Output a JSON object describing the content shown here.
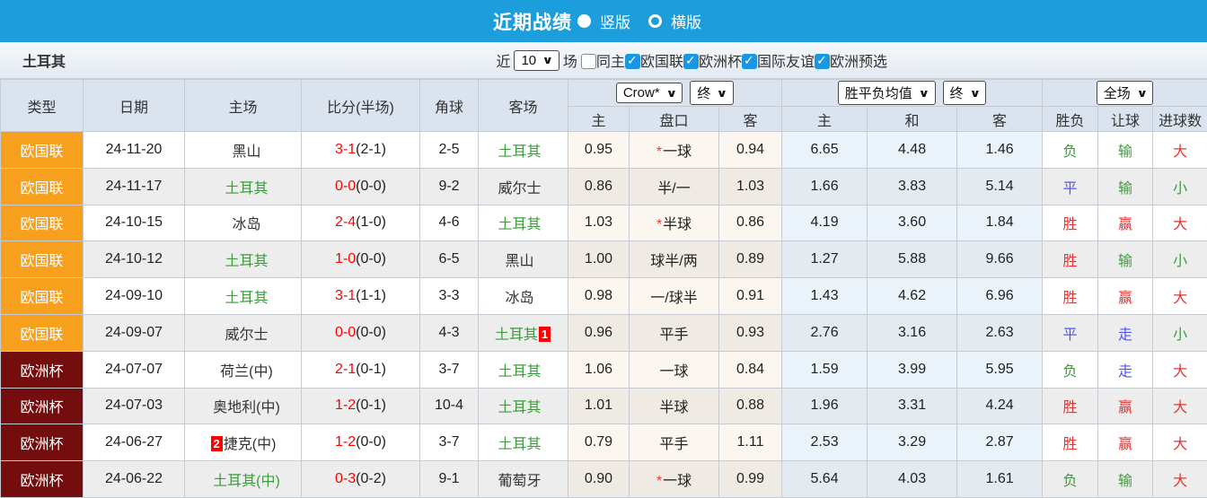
{
  "colors": {
    "topbar_blue": "#1C9EDC",
    "league_nations_orange": "#F7A01D",
    "league_euro_darkred": "#740D0D",
    "win_red": "#E83333",
    "lose_green": "#3E9B3E",
    "draw_blue": "#5353F2",
    "turkey_team_green": "#3E9B3E",
    "score_red": "#FF0000",
    "badge_red": "#FF0000"
  },
  "titlebar": {
    "title": "近期战绩",
    "radios": [
      {
        "label": "竖版",
        "selected": true
      },
      {
        "label": "横版",
        "selected": false
      }
    ]
  },
  "filterbar": {
    "team": "土耳其",
    "recent_label": "近",
    "recent_value": "10",
    "matches_label": "场",
    "checkboxes": [
      {
        "label": "同主",
        "checked": false
      },
      {
        "label": "欧国联",
        "checked": true
      },
      {
        "label": "欧洲杯",
        "checked": true
      },
      {
        "label": "国际友谊",
        "checked": true
      },
      {
        "label": "欧洲预选",
        "checked": true
      }
    ]
  },
  "table": {
    "selectors": {
      "bookmaker": "Crow*",
      "bookmaker_stage": "终",
      "avg_label": "胜平负均值",
      "avg_stage": "终",
      "scope": "全场"
    },
    "col_headers": {
      "type": "类型",
      "date": "日期",
      "home": "主场",
      "score": "比分(半场)",
      "corner": "角球",
      "away": "客场",
      "odds_home": "主",
      "odds_line": "盘口",
      "odds_away": "客",
      "avg_home": "主",
      "avg_draw": "和",
      "avg_away": "客",
      "result_wdl": "胜负",
      "result_handicap": "让球",
      "result_goals": "进球数"
    },
    "rows": [
      {
        "type": "欧国联",
        "date": "24-11-20",
        "home": "黑山",
        "home_turkey": false,
        "home_badge": "",
        "score": "3-1",
        "half": "(2-1)",
        "corner": "2-5",
        "away": "土耳其",
        "away_turkey": true,
        "away_badge": "",
        "odds_home": "0.95",
        "line": "*一球",
        "odds_away": "0.94",
        "avg_home": "6.65",
        "avg_draw": "4.48",
        "avg_away": "1.46",
        "wdl": {
          "text": "负",
          "tone": "green"
        },
        "hcp": {
          "text": "输",
          "tone": "green"
        },
        "goals": {
          "text": "大",
          "tone": "red"
        }
      },
      {
        "type": "欧国联",
        "date": "24-11-17",
        "home": "土耳其",
        "home_turkey": true,
        "home_badge": "",
        "score": "0-0",
        "half": "(0-0)",
        "corner": "9-2",
        "away": "威尔士",
        "away_turkey": false,
        "away_badge": "",
        "odds_home": "0.86",
        "line": "半/一",
        "odds_away": "1.03",
        "avg_home": "1.66",
        "avg_draw": "3.83",
        "avg_away": "5.14",
        "wdl": {
          "text": "平",
          "tone": "blue"
        },
        "hcp": {
          "text": "输",
          "tone": "green"
        },
        "goals": {
          "text": "小",
          "tone": "green"
        }
      },
      {
        "type": "欧国联",
        "date": "24-10-15",
        "home": "冰岛",
        "home_turkey": false,
        "home_badge": "",
        "score": "2-4",
        "half": "(1-0)",
        "corner": "4-6",
        "away": "土耳其",
        "away_turkey": true,
        "away_badge": "",
        "odds_home": "1.03",
        "line": "*半球",
        "odds_away": "0.86",
        "avg_home": "4.19",
        "avg_draw": "3.60",
        "avg_away": "1.84",
        "wdl": {
          "text": "胜",
          "tone": "red"
        },
        "hcp": {
          "text": "赢",
          "tone": "red"
        },
        "goals": {
          "text": "大",
          "tone": "red"
        }
      },
      {
        "type": "欧国联",
        "date": "24-10-12",
        "home": "土耳其",
        "home_turkey": true,
        "home_badge": "",
        "score": "1-0",
        "half": "(0-0)",
        "corner": "6-5",
        "away": "黑山",
        "away_turkey": false,
        "away_badge": "",
        "odds_home": "1.00",
        "line": "球半/两",
        "odds_away": "0.89",
        "avg_home": "1.27",
        "avg_draw": "5.88",
        "avg_away": "9.66",
        "wdl": {
          "text": "胜",
          "tone": "red"
        },
        "hcp": {
          "text": "输",
          "tone": "green"
        },
        "goals": {
          "text": "小",
          "tone": "green"
        }
      },
      {
        "type": "欧国联",
        "date": "24-09-10",
        "home": "土耳其",
        "home_turkey": true,
        "home_badge": "",
        "score": "3-1",
        "half": "(1-1)",
        "corner": "3-3",
        "away": "冰岛",
        "away_turkey": false,
        "away_badge": "",
        "odds_home": "0.98",
        "line": "一/球半",
        "odds_away": "0.91",
        "avg_home": "1.43",
        "avg_draw": "4.62",
        "avg_away": "6.96",
        "wdl": {
          "text": "胜",
          "tone": "red"
        },
        "hcp": {
          "text": "赢",
          "tone": "red"
        },
        "goals": {
          "text": "大",
          "tone": "red"
        }
      },
      {
        "type": "欧国联",
        "date": "24-09-07",
        "home": "威尔士",
        "home_turkey": false,
        "home_badge": "",
        "score": "0-0",
        "half": "(0-0)",
        "corner": "4-3",
        "away": "土耳其",
        "away_turkey": true,
        "away_badge": "1",
        "odds_home": "0.96",
        "line": "平手",
        "odds_away": "0.93",
        "avg_home": "2.76",
        "avg_draw": "3.16",
        "avg_away": "2.63",
        "wdl": {
          "text": "平",
          "tone": "blue"
        },
        "hcp": {
          "text": "走",
          "tone": "blue"
        },
        "goals": {
          "text": "小",
          "tone": "green"
        }
      },
      {
        "type": "欧洲杯",
        "date": "24-07-07",
        "home": "荷兰(中)",
        "home_turkey": false,
        "home_badge": "",
        "score": "2-1",
        "half": "(0-1)",
        "corner": "3-7",
        "away": "土耳其",
        "away_turkey": true,
        "away_badge": "",
        "odds_home": "1.06",
        "line": "一球",
        "odds_away": "0.84",
        "avg_home": "1.59",
        "avg_draw": "3.99",
        "avg_away": "5.95",
        "wdl": {
          "text": "负",
          "tone": "green"
        },
        "hcp": {
          "text": "走",
          "tone": "blue"
        },
        "goals": {
          "text": "大",
          "tone": "red"
        }
      },
      {
        "type": "欧洲杯",
        "date": "24-07-03",
        "home": "奥地利(中)",
        "home_turkey": false,
        "home_badge": "",
        "score": "1-2",
        "half": "(0-1)",
        "corner": "10-4",
        "away": "土耳其",
        "away_turkey": true,
        "away_badge": "",
        "odds_home": "1.01",
        "line": "半球",
        "odds_away": "0.88",
        "avg_home": "1.96",
        "avg_draw": "3.31",
        "avg_away": "4.24",
        "wdl": {
          "text": "胜",
          "tone": "red"
        },
        "hcp": {
          "text": "赢",
          "tone": "red"
        },
        "goals": {
          "text": "大",
          "tone": "red"
        }
      },
      {
        "type": "欧洲杯",
        "date": "24-06-27",
        "home": "捷克(中)",
        "home_turkey": false,
        "home_badge": "2",
        "score": "1-2",
        "half": "(0-0)",
        "corner": "3-7",
        "away": "土耳其",
        "away_turkey": true,
        "away_badge": "",
        "odds_home": "0.79",
        "line": "平手",
        "odds_away": "1.11",
        "avg_home": "2.53",
        "avg_draw": "3.29",
        "avg_away": "2.87",
        "wdl": {
          "text": "胜",
          "tone": "red"
        },
        "hcp": {
          "text": "赢",
          "tone": "red"
        },
        "goals": {
          "text": "大",
          "tone": "red"
        }
      },
      {
        "type": "欧洲杯",
        "date": "24-06-22",
        "home": "土耳其(中)",
        "home_turkey": true,
        "home_badge": "",
        "score": "0-3",
        "half": "(0-2)",
        "corner": "9-1",
        "away": "葡萄牙",
        "away_turkey": false,
        "away_badge": "",
        "odds_home": "0.90",
        "line": "*一球",
        "odds_away": "0.99",
        "avg_home": "5.64",
        "avg_draw": "4.03",
        "avg_away": "1.61",
        "wdl": {
          "text": "负",
          "tone": "green"
        },
        "hcp": {
          "text": "输",
          "tone": "green"
        },
        "goals": {
          "text": "大",
          "tone": "red"
        }
      }
    ]
  }
}
